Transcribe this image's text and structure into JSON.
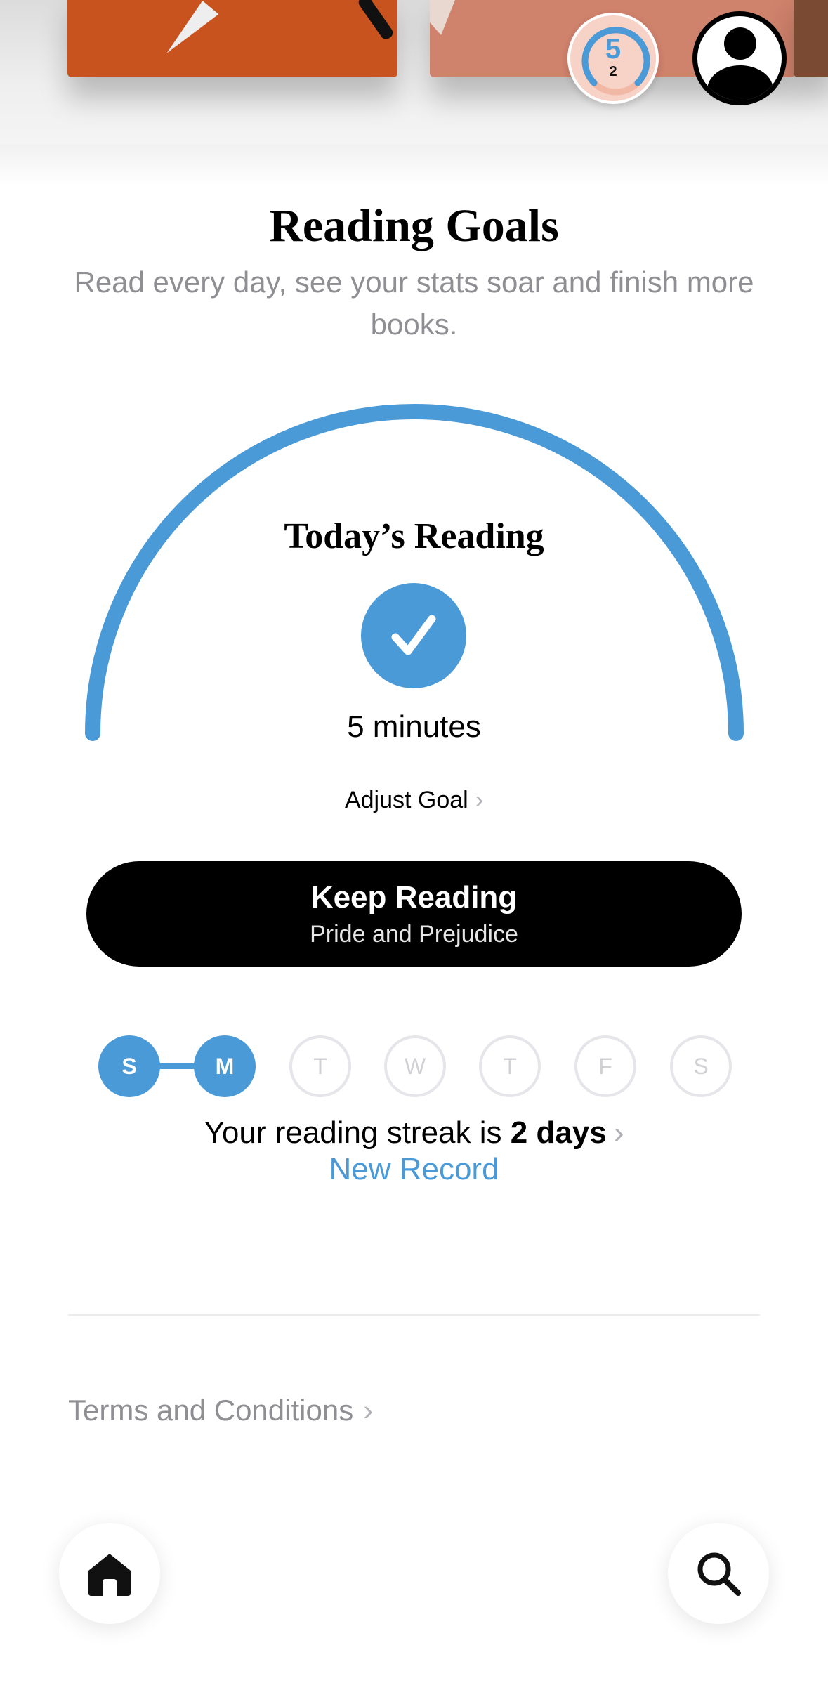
{
  "header": {
    "goal_badge": {
      "value": "5",
      "count": "2",
      "progress": 0.75,
      "color": "#4a9ad8"
    },
    "profile_icon": "person-circle-icon"
  },
  "intro": {
    "title": "Reading Goals",
    "subtitle": "Read every day, see your stats soar and finish more books."
  },
  "today": {
    "label": "Today’s Reading",
    "status_icon": "checkmark-icon",
    "minutes": "5 minutes",
    "progress": 1.0,
    "adjust_goal": "Adjust Goal",
    "accent": "#4a9ad8"
  },
  "keep_reading": {
    "label": "Keep Reading",
    "book": "Pride and Prejudice"
  },
  "week": {
    "days": [
      {
        "letter": "S",
        "done": true
      },
      {
        "letter": "M",
        "done": true
      },
      {
        "letter": "T",
        "done": false
      },
      {
        "letter": "W",
        "done": false
      },
      {
        "letter": "T",
        "done": false
      },
      {
        "letter": "F",
        "done": false
      },
      {
        "letter": "S",
        "done": false
      }
    ]
  },
  "streak": {
    "prefix": "Your reading streak is",
    "value": "2 days",
    "record": "New Record"
  },
  "footer": {
    "terms": "Terms and Conditions"
  },
  "tabs": {
    "home_icon": "home-icon",
    "search_icon": "search-icon"
  }
}
